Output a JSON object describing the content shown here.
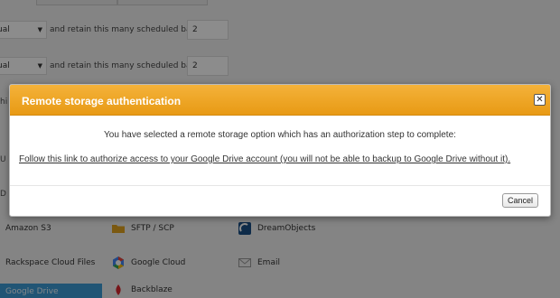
{
  "background": {
    "schedules": [
      {
        "select_value": "ual",
        "retain_label": "and retain this many scheduled backups:",
        "retain_value": "2"
      },
      {
        "select_value": "ual",
        "retain_label": "and retain this many scheduled backups:",
        "retain_value": "2"
      }
    ],
    "side_letters": [
      "hi",
      "U",
      "D"
    ],
    "storage_options": [
      {
        "label": "Amazon S3",
        "icon": "amazon-s3-icon"
      },
      {
        "label": "SFTP / SCP",
        "icon": "folder-icon"
      },
      {
        "label": "DreamObjects",
        "icon": "dreamobjects-icon"
      },
      {
        "label": "Rackspace Cloud Files",
        "icon": "rackspace-icon"
      },
      {
        "label": "Google Cloud",
        "icon": "google-cloud-icon"
      },
      {
        "label": "Email",
        "icon": "email-icon"
      }
    ],
    "selected_storage_label": "Google Drive",
    "partial_storage_label": "Backblaze"
  },
  "dialog": {
    "title": "Remote storage authentication",
    "close_glyph": "✕",
    "message": "You have selected a remote storage option which has an authorization step to complete:",
    "link_text": "Follow this link to authorize access to your Google Drive account (you will not be able to backup to Google Drive without it).",
    "cancel_label": "Cancel"
  },
  "colors": {
    "titlebar": "#f0a62a",
    "overlay": "rgba(0,0,0,0.45)",
    "selected_tile": "#3c9bd6"
  }
}
